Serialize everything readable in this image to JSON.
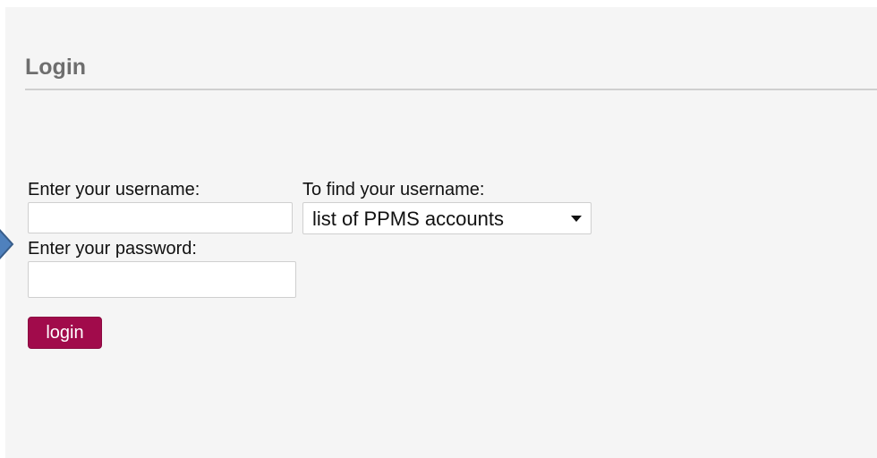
{
  "page": {
    "title": "Login"
  },
  "form": {
    "username_label": "Enter your username:",
    "username_value": "",
    "find_username_label": "To find your username:",
    "accounts_select": {
      "selected": "list of PPMS accounts"
    },
    "password_label": "Enter your password:",
    "password_value": "",
    "login_label": "login"
  },
  "colors": {
    "button_bg": "#a10b4b",
    "panel_bg": "#f5f5f5",
    "title_color": "#6e6e6e",
    "arrow_fill": "#4f81bd"
  },
  "icons": {
    "select_arrow": "chevron-down-icon",
    "pointer": "arrow-right-icon"
  }
}
